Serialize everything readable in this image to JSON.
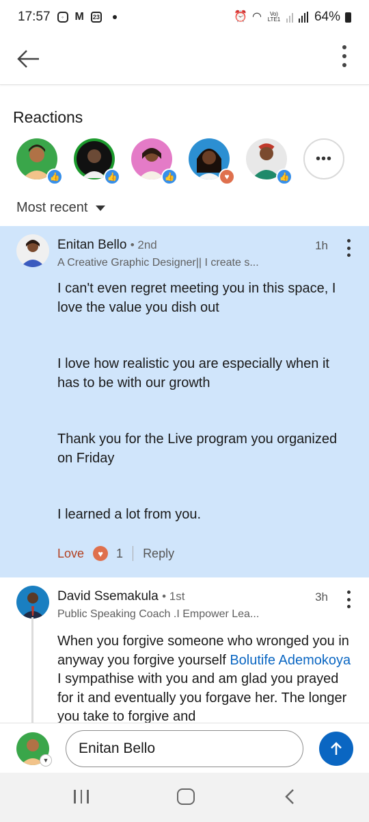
{
  "status_bar": {
    "time": "17:57",
    "left_icons": [
      "instagram-icon",
      "gmail-icon",
      "calendar-icon"
    ],
    "calendar_day": "23",
    "network_label": "Vo) LTE1",
    "battery": "64%"
  },
  "reactions": {
    "title": "Reactions",
    "reactors": [
      {
        "badge": "like",
        "colors": [
          "#3aa64a",
          "#f2c38a"
        ]
      },
      {
        "badge": "like",
        "colors": [
          "#1c9a2d",
          "#2a2a2a"
        ]
      },
      {
        "badge": "like",
        "colors": [
          "#e47bc7",
          "#3b2418"
        ]
      },
      {
        "badge": "love",
        "colors": [
          "#2c8fd2",
          "#2c1a12"
        ]
      },
      {
        "badge": "like",
        "colors": [
          "#e8e8e8",
          "#1f8a6a"
        ]
      }
    ],
    "more_label": "•••"
  },
  "sort": {
    "label": "Most recent"
  },
  "comments": [
    {
      "name": "Enitan Bello",
      "degree": "• 2nd",
      "headline": "A Creative Graphic Designer|| I create s...",
      "time": "1h",
      "paragraphs": [
        "I can't even regret meeting you in this space, I love the value you dish out",
        "I love how realistic you are especially when it has to be with our growth",
        "Thank you for the Live program you organized on Friday",
        "I learned a lot from you."
      ],
      "reaction_label": "Love",
      "reaction_count": "1",
      "reply_label": "Reply"
    },
    {
      "name": "David Ssemakula",
      "degree": "• 1st",
      "headline": "Public Speaking Coach .I Empower Lea...",
      "time": "3h",
      "text_before": "When you forgive someone who wronged you in anyway you forgive yourself ",
      "mention": "Bolutife Ademokoya",
      "text_after": " I sympathise with you and am glad you prayed for it and eventually you forgave her. The longer you take to forgive and"
    }
  ],
  "composer": {
    "value": "Enitan Bello"
  },
  "colors": {
    "brand_blue": "#0a66c2",
    "highlight": "#d0e5fb",
    "love": "#df704d"
  }
}
